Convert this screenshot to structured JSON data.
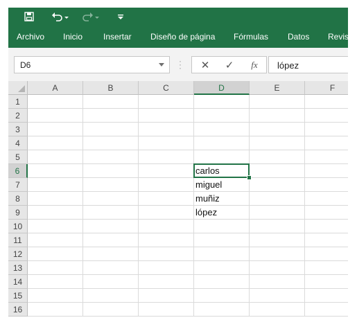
{
  "ribbon": {
    "color": "#217346",
    "tabs": [
      "Archivo",
      "Inicio",
      "Insertar",
      "Diseño de página",
      "Fórmulas",
      "Datos",
      "Revis"
    ]
  },
  "quick_access": {
    "icons": [
      "save-icon",
      "undo-icon",
      "redo-icon",
      "customize-qat-icon"
    ]
  },
  "formula_bar": {
    "name_box": "D6",
    "cancel_icon": "✕",
    "enter_icon": "✓",
    "fx_label": "fx",
    "content": "lópez"
  },
  "sheet": {
    "columns": [
      "A",
      "B",
      "C",
      "D",
      "E",
      "F"
    ],
    "rows": [
      "1",
      "2",
      "3",
      "4",
      "5",
      "6",
      "7",
      "8",
      "9",
      "10",
      "11",
      "12",
      "13",
      "14",
      "15",
      "16"
    ],
    "active_cell": "D6",
    "cells": {
      "D6": "carlos",
      "D7": "miguel",
      "D8": "muñiz",
      "D9": "lópez"
    }
  }
}
